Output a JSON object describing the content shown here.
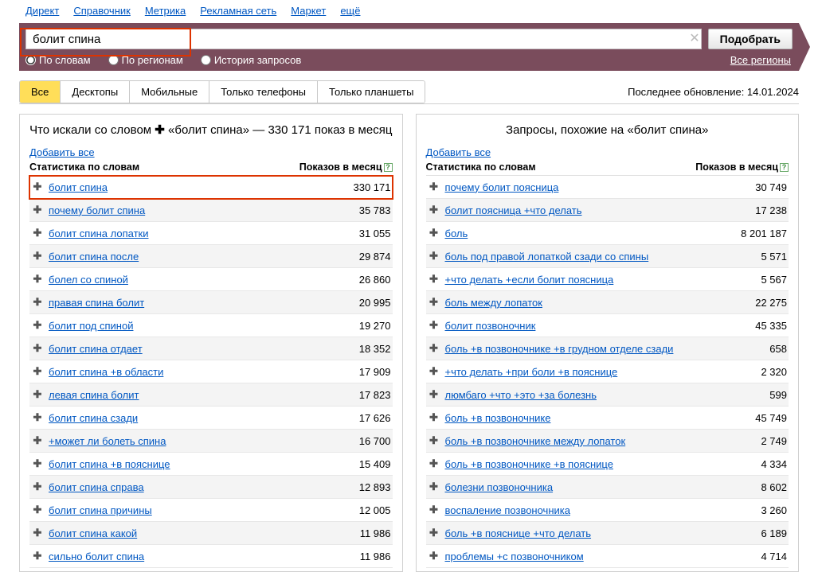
{
  "topnav": {
    "links": [
      "Директ",
      "Справочник",
      "Метрика",
      "Рекламная сеть",
      "Маркет",
      "ещё"
    ]
  },
  "search": {
    "value": "болит спина",
    "button": "Подобрать"
  },
  "radios": {
    "by_words": "По словам",
    "by_regions": "По регионам",
    "history": "История запросов",
    "all_regions": "Все регионы"
  },
  "device_tabs": {
    "all": "Все",
    "desktops": "Десктопы",
    "mobile": "Мобильные",
    "phones": "Только телефоны",
    "tablets": "Только планшеты"
  },
  "last_update": "Последнее обновление: 14.01.2024",
  "left_panel": {
    "title_prefix": "Что искали со словом ",
    "title_query": "«болит спина»",
    "title_suffix": " — 330 171 показ в месяц",
    "add_all": "Добавить все",
    "th_stat": "Статистика по словам",
    "th_imp": "Показов в месяц",
    "rows": [
      {
        "kw": "болит спина",
        "v": "330 171",
        "hl": true
      },
      {
        "kw": "почему болит спина",
        "v": "35 783"
      },
      {
        "kw": "болит спина лопатки",
        "v": "31 055"
      },
      {
        "kw": "болит спина после",
        "v": "29 874"
      },
      {
        "kw": "болел со спиной",
        "v": "26 860"
      },
      {
        "kw": "правая спина болит",
        "v": "20 995"
      },
      {
        "kw": "болит под спиной",
        "v": "19 270"
      },
      {
        "kw": "болит спина отдает",
        "v": "18 352"
      },
      {
        "kw": "болит спина +в области",
        "v": "17 909"
      },
      {
        "kw": "левая спина болит",
        "v": "17 823"
      },
      {
        "kw": "болит спина сзади",
        "v": "17 626"
      },
      {
        "kw": "+может ли болеть спина",
        "v": "16 700"
      },
      {
        "kw": "болит спина +в пояснице",
        "v": "15 409"
      },
      {
        "kw": "болит спина справа",
        "v": "12 893"
      },
      {
        "kw": "болит спина причины",
        "v": "12 005"
      },
      {
        "kw": "болит спина какой",
        "v": "11 986"
      },
      {
        "kw": "сильно болит спина",
        "v": "11 986"
      }
    ]
  },
  "right_panel": {
    "title": "Запросы, похожие на «болит спина»",
    "add_all": "Добавить все",
    "th_stat": "Статистика по словам",
    "th_imp": "Показов в месяц",
    "rows": [
      {
        "kw": "почему болит поясница",
        "v": "30 749"
      },
      {
        "kw": "болит поясница +что делать",
        "v": "17 238"
      },
      {
        "kw": "боль",
        "v": "8 201 187"
      },
      {
        "kw": "боль под правой лопаткой сзади со спины",
        "v": "5 571"
      },
      {
        "kw": "+что делать +если болит поясница",
        "v": "5 567"
      },
      {
        "kw": "боль между лопаток",
        "v": "22 275"
      },
      {
        "kw": "болит позвоночник",
        "v": "45 335"
      },
      {
        "kw": "боль +в позвоночнике +в грудном отделе сзади",
        "v": "658"
      },
      {
        "kw": "+что делать +при боли +в пояснице",
        "v": "2 320"
      },
      {
        "kw": "люмбаго +что +это +за болезнь",
        "v": "599"
      },
      {
        "kw": "боль +в позвоночнике",
        "v": "45 749"
      },
      {
        "kw": "боль +в позвоночнике между лопаток",
        "v": "2 749"
      },
      {
        "kw": "боль +в позвоночнике +в пояснице",
        "v": "4 334"
      },
      {
        "kw": "болезни позвоночника",
        "v": "8 602"
      },
      {
        "kw": "воспаление позвоночника",
        "v": "3 260"
      },
      {
        "kw": "боль +в пояснице +что делать",
        "v": "6 189"
      },
      {
        "kw": "проблемы +с позвоночником",
        "v": "4 714"
      }
    ]
  }
}
